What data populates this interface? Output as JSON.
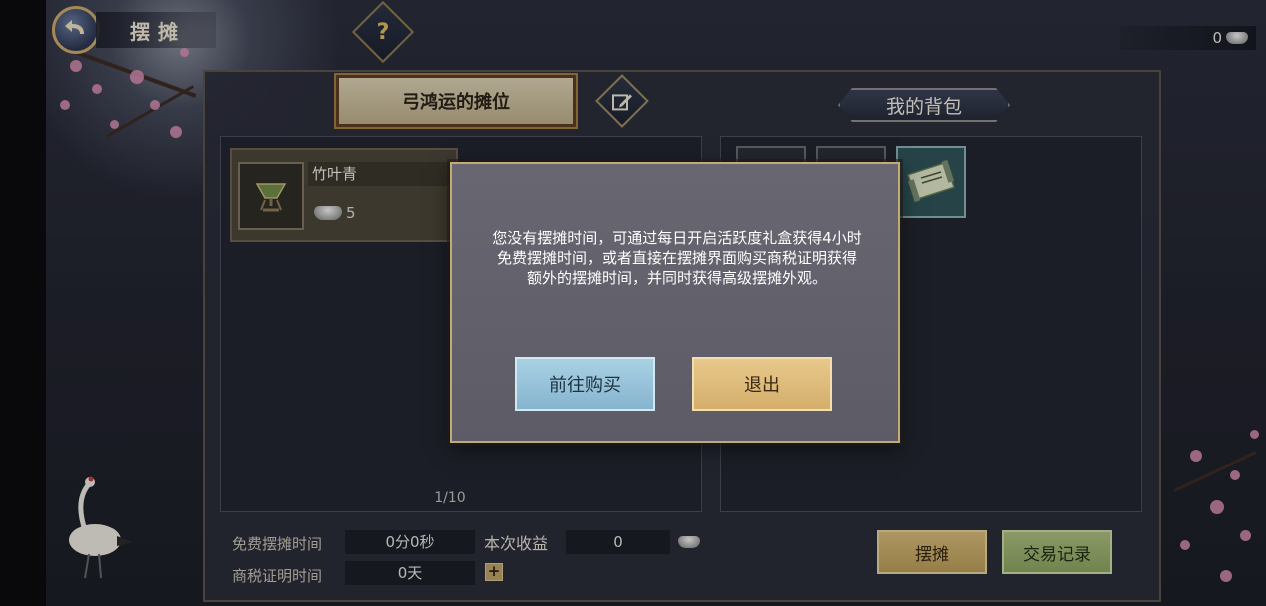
{
  "header": {
    "title": "摆摊",
    "help_symbol": "?",
    "currency_value": "0"
  },
  "stall": {
    "tab_label": "弓鸿运的摊位",
    "items": [
      {
        "name": "竹叶青",
        "price": "5"
      }
    ],
    "page": "1/10"
  },
  "bag": {
    "tab_label": "我的背包"
  },
  "info": {
    "free_time_label": "免费摆摊时间",
    "free_time_value": "0分0秒",
    "income_label": "本次收益",
    "income_value": "0",
    "tax_cert_label": "商税证明时间",
    "tax_cert_value": "0天",
    "plus": "+"
  },
  "buttons": {
    "stall": "摆摊",
    "records": "交易记录"
  },
  "modal": {
    "message": "您没有摆摊时间，可通过每日开启活跃度礼盒获得4小时免费摆摊时间，或者直接在摆摊界面购买商税证明获得额外的摆摊时间，并同时获得高级摆摊外观。",
    "buy_label": "前往购买",
    "exit_label": "退出"
  },
  "colors": {
    "modal_bg": "#5d5b66",
    "buy_button": "#86b4cf",
    "exit_button": "#d4ae6b",
    "stall_button": "#c8ab68",
    "record_button": "#94a86a"
  },
  "icons": [
    "back-arrow-icon",
    "help-icon",
    "silver-ingot-icon",
    "edit-icon",
    "cup-icon",
    "scroll-icon"
  ]
}
